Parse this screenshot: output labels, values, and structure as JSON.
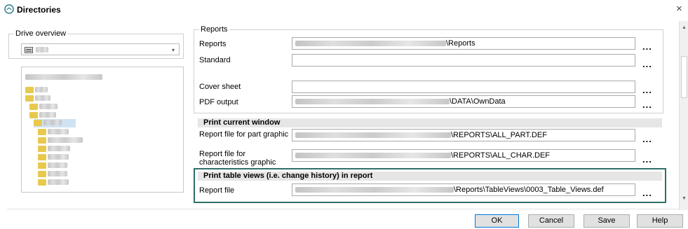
{
  "window": {
    "title": "Directories",
    "close_glyph": "×",
    "icon": "directories-app-icon"
  },
  "drive_overview": {
    "group_label": "Drive overview",
    "combo_arrow_glyph": "▾"
  },
  "reports_group": {
    "group_label": "Reports",
    "rows": [
      {
        "label": "Reports",
        "value_suffix": "\\Reports"
      },
      {
        "label": "Standard",
        "value_suffix": ""
      },
      {
        "label": "Cover sheet",
        "value_suffix": ""
      },
      {
        "label": "PDF output",
        "value_suffix": "\\DATA\\OwnData"
      }
    ]
  },
  "print_current_window": {
    "header": "Print current window",
    "rows": [
      {
        "label": "Report file for part graphic",
        "value_suffix": "\\REPORTS\\ALL_PART.DEF"
      },
      {
        "label": "Report file for characteristics graphic",
        "value_suffix": "\\REPORTS\\ALL_CHAR.DEF"
      }
    ]
  },
  "print_table_views": {
    "header": "Print table views (i.e. change history) in report",
    "rows": [
      {
        "label": "Report file",
        "value_suffix": "\\Reports\\TableViews\\0003_Table_Views.def"
      }
    ]
  },
  "browse_glyph": "...",
  "buttons": {
    "ok": "OK",
    "cancel": "Cancel",
    "save": "Save",
    "help": "Help"
  },
  "scrollbar": {
    "up_glyph": "▲",
    "down_glyph": "▼"
  },
  "colors": {
    "highlight_border": "#2e6f6b",
    "section_header_bg": "#e6e6e6",
    "folder": "#e8c94e"
  }
}
